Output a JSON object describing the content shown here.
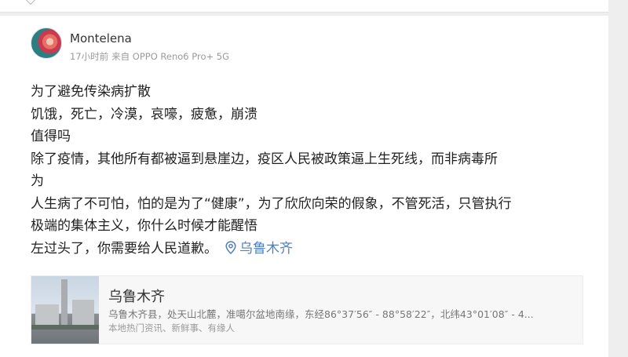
{
  "post": {
    "author": "Montelena",
    "time": "17小时前",
    "source": "来自 OPPO Reno6 Pro+ 5G",
    "lines": [
      "为了避免传染病扩散",
      "饥饿，死亡，冷漠，哀嚎，疲惫，崩溃",
      "值得吗",
      "除了疫情，其他所有都被逼到悬崖边，疫区人民被政策逼上生死线，而非病毒所",
      "为",
      "人生病了不可怕，怕的是为了“健康”，为了欣欣向荣的假象，不管死活，只管执行",
      "极端的集体主义，你什么时候才能醒悟"
    ],
    "last_line": "左过头了，你需要给人民道歉。",
    "location_link": "乌鲁木齐"
  },
  "location_card": {
    "title": "乌鲁木齐",
    "description": "乌鲁木齐县，处天山北麓，准噶尔盆地南缘，东经86°37′56″ - 88°58′22″，北纬43°01′08″ - 4...",
    "subtitle": "本地热门资讯、新鲜事、有缘人"
  },
  "colors": {
    "link": "#4f7fbd",
    "text": "#222222",
    "meta": "#9a9a9a"
  }
}
